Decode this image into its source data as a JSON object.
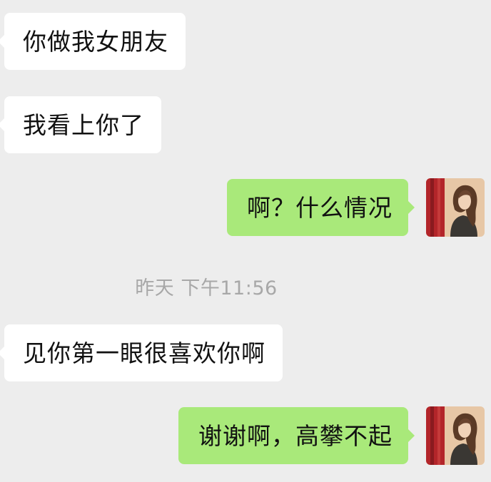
{
  "messages": [
    {
      "side": "in",
      "text": "你做我女朋友"
    },
    {
      "side": "in",
      "text": "我看上你了"
    },
    {
      "side": "out",
      "text": "啊？什么情况"
    },
    {
      "side": "in",
      "text": "见你第一眼很喜欢你啊"
    },
    {
      "side": "out",
      "text": "谢谢啊，高攀不起"
    }
  ],
  "timestamp": "昨天 下午11:56",
  "colors": {
    "background": "#ededed",
    "incoming_bubble": "#ffffff",
    "outgoing_bubble": "#a9e97a",
    "timestamp_text": "#a8a8a8"
  },
  "icons": {
    "avatar": "user-avatar-photo"
  }
}
